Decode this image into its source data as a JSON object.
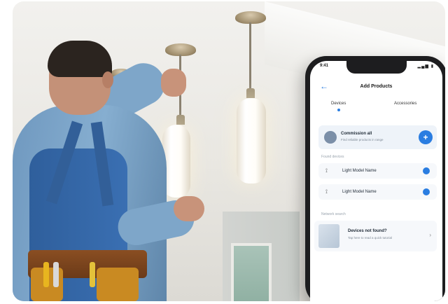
{
  "app": {
    "status_time": "9:41",
    "status_icons": "▂▄▆ ▮",
    "title": "Add Products",
    "back_icon": "arrow-left-icon",
    "tabs": [
      {
        "label": "Devices",
        "active": true
      },
      {
        "label": "Accessories",
        "active": false
      }
    ],
    "commission_all": {
      "title": "Commission all",
      "subtitle": "Find reliable products in range"
    },
    "sections": {
      "found": "Found devices",
      "search": "Network search"
    },
    "devices": [
      {
        "label": "Light Model Name",
        "icon": "bulb-icon"
      },
      {
        "label": "Light Model Name",
        "icon": "bulb-icon"
      }
    ],
    "not_found": {
      "title": "Devices not found?",
      "subtitle": "Tap here to read a quick tutorial"
    },
    "accent_color": "#2a7de1"
  }
}
